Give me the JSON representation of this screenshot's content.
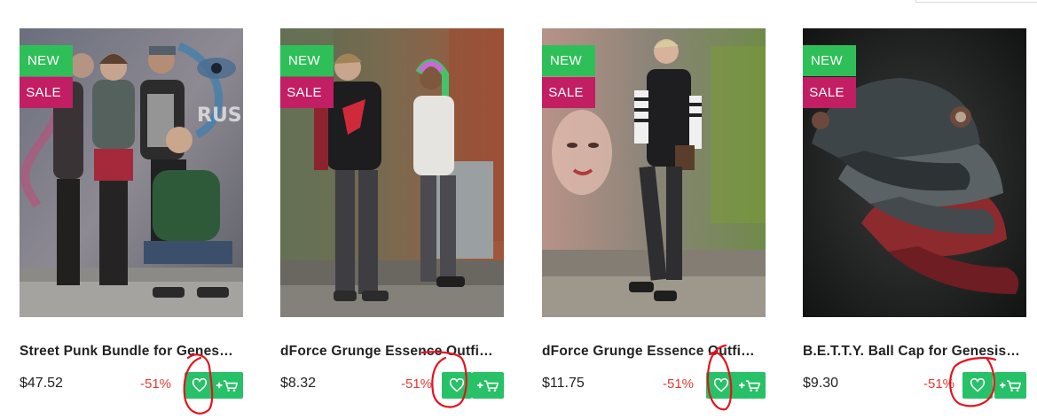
{
  "products": [
    {
      "badges": {
        "new": "NEW",
        "sale": "SALE"
      },
      "title": "Street Punk Bundle for Genes…",
      "price": "$47.52",
      "discount": "-51%",
      "wishlist_icon": "heart-icon",
      "cart_icon": "plus-cart-icon"
    },
    {
      "badges": {
        "new": "NEW",
        "sale": "SALE"
      },
      "title": "dForce Grunge Essence Outfi…",
      "price": "$8.32",
      "discount": "-51%",
      "wishlist_icon": "heart-icon",
      "cart_icon": "plus-cart-icon"
    },
    {
      "badges": {
        "new": "NEW",
        "sale": "SALE"
      },
      "title": "dForce Grunge Essence Outfi…",
      "price": "$11.75",
      "discount": "-51%",
      "wishlist_icon": "heart-icon",
      "cart_icon": "plus-cart-icon"
    },
    {
      "badges": {
        "new": "NEW",
        "sale": "SALE"
      },
      "title": "B.E.T.T.Y. Ball Cap for Genesis…",
      "price": "$9.30",
      "discount": "-51%",
      "wishlist_icon": "heart-icon",
      "cart_icon": "plus-cart-icon"
    }
  ],
  "colors": {
    "badge_new": "#2fbf59",
    "badge_sale": "#c21e63",
    "action_button": "#27c167",
    "discount": "#e53935",
    "annotation": "#e5121e"
  }
}
